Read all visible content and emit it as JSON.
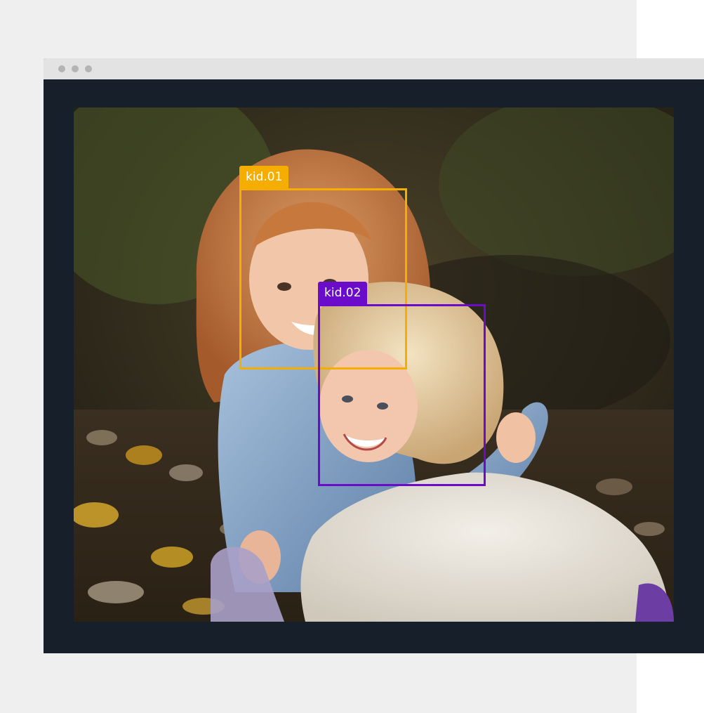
{
  "colors": {
    "kid01": "#f5ad00",
    "kid02": "#6a0cc9",
    "window_frame": "#17202a",
    "titlebar": "#e3e3e3"
  },
  "titlebar": {
    "controls": [
      "dot-icon",
      "dot-icon",
      "dot-icon"
    ]
  },
  "annotations": [
    {
      "label": "kid.01"
    },
    {
      "label": "kid.02"
    }
  ]
}
